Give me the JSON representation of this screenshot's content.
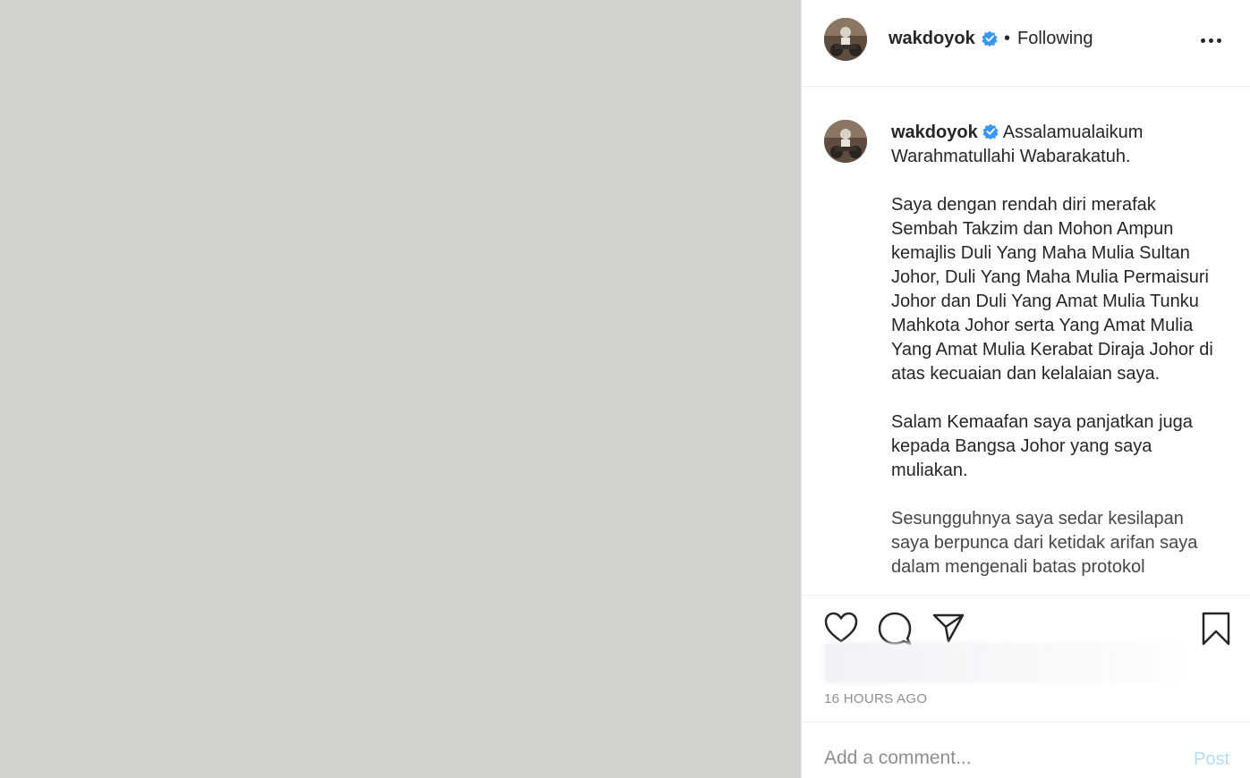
{
  "post": {
    "username": "wakdoyok",
    "verified": true,
    "separator": "•",
    "follow_status": "Following",
    "more_icon": "more-options-icon"
  },
  "caption": {
    "username": "wakdoyok",
    "paragraphs": [
      "Assalamualaikum Warahmatullahi Wabarakatuh.",
      "Saya dengan rendah diri merafak Sembah Takzim dan Mohon Ampun kemajlis Duli Yang Maha Mulia Sultan Johor, Duli Yang Maha Mulia Permaisuri Johor dan Duli Yang Amat Mulia Tunku Mahkota Johor serta Yang Amat Mulia Yang Amat Mulia Kerabat Diraja Johor di atas kecuaian dan kelalaian saya.",
      "Salam Kemaafan saya panjatkan juga kepada Bangsa Johor yang saya muliakan.",
      "Sesungguhnya saya sedar kesilapan saya berpunca dari ketidak arifan saya dalam mengenali batas protokol"
    ]
  },
  "actions": {
    "like_icon": "heart-icon",
    "comment_icon": "comment-icon",
    "share_icon": "share-icon",
    "save_icon": "bookmark-icon"
  },
  "timestamp": "16 HOURS AGO",
  "comment_box": {
    "placeholder": "Add a comment...",
    "post_label": "Post"
  },
  "colors": {
    "media_bg": "#d2d3ce",
    "verified_blue": "#3897f0",
    "post_button_disabled": "#b3dbff",
    "text_primary": "#262626",
    "text_secondary": "#8e8e8e"
  }
}
